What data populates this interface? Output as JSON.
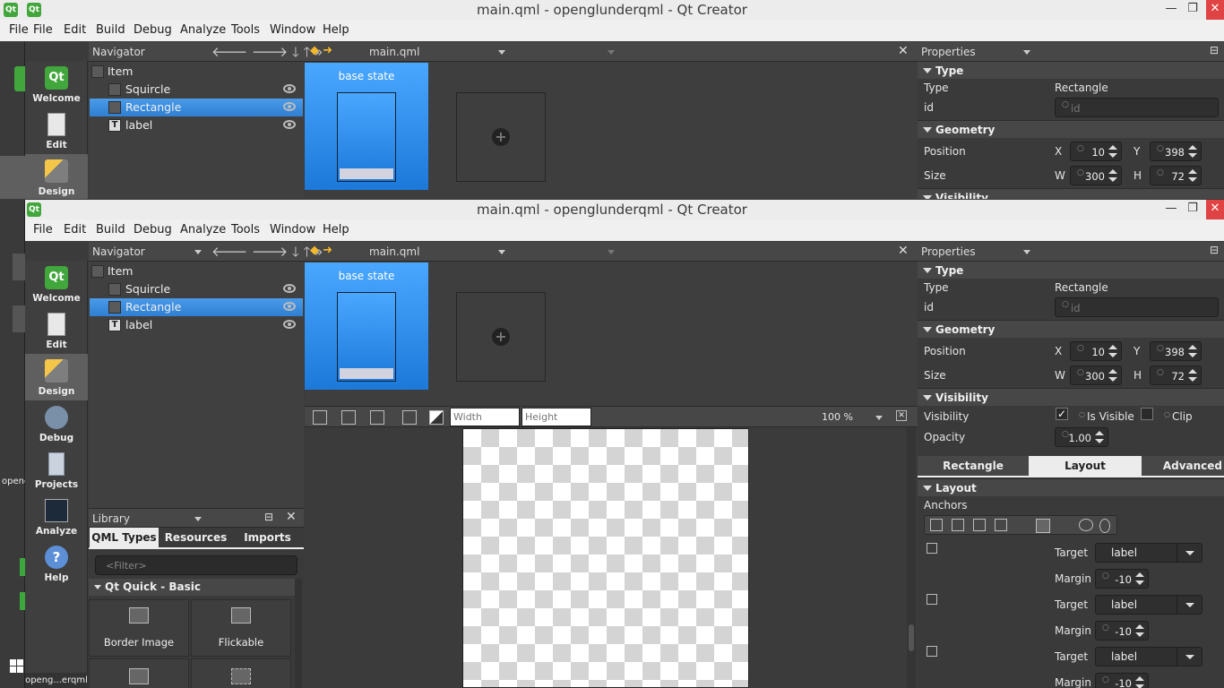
{
  "window": {
    "title": "main.qml - openglunderqml - Qt Creator",
    "qt_icon_text": "Qt",
    "minimize": "—",
    "maximize": "❐",
    "close": "✕"
  },
  "menu": [
    "File",
    "Edit",
    "Build",
    "Debug",
    "Analyze",
    "Tools",
    "Window",
    "Help"
  ],
  "modes": [
    {
      "label": "Welcome",
      "icon": "qt-logo-icon"
    },
    {
      "label": "Edit",
      "icon": "edit-document-icon"
    },
    {
      "label": "Design",
      "icon": "design-brush-icon"
    },
    {
      "label": "Debug",
      "icon": "debug-bug-icon"
    },
    {
      "label": "Projects",
      "icon": "projects-icon"
    },
    {
      "label": "Analyze",
      "icon": "analyze-icon"
    },
    {
      "label": "Help",
      "icon": "help-icon"
    }
  ],
  "navigator": {
    "title": "Navigator",
    "items": [
      {
        "label": "Item"
      },
      {
        "label": "Squircle"
      },
      {
        "label": "Rectangle"
      },
      {
        "label": "label"
      }
    ]
  },
  "editor": {
    "file": "main.qml",
    "state_caption": "base state",
    "width_placeholder": "Width",
    "height_placeholder": "Height",
    "zoom": "100 %"
  },
  "library": {
    "title": "Library",
    "tabs": [
      "QML Types",
      "Resources",
      "Imports"
    ],
    "filter_placeholder": "<Filter>",
    "section": "Qt Quick - Basic",
    "items": [
      "Border Image",
      "Flickable"
    ]
  },
  "properties": {
    "title": "Properties",
    "type_section": "Type",
    "type_label": "Type",
    "type_value": "Rectangle",
    "id_label": "id",
    "id_placeholder": "id",
    "geometry_section": "Geometry",
    "position_label": "Position",
    "size_label": "Size",
    "x_label": "X",
    "y_label": "Y",
    "w_label": "W",
    "h_label": "H",
    "x": "10",
    "y": "398",
    "w": "300",
    "h": "72",
    "visibility_section": "Visibility",
    "visibility_label": "Visibility",
    "is_visible": "Is Visible",
    "clip": "Clip",
    "opacity_label": "Opacity",
    "opacity": "1.00",
    "tabs": [
      "Rectangle",
      "Layout",
      "Advanced"
    ],
    "layout_section": "Layout",
    "anchors_label": "Anchors",
    "target_label": "Target",
    "target_value": "label",
    "margin_label": "Margin",
    "margin_value": "-10"
  },
  "taskbar": {
    "app_label": "openg...erqml",
    "side_label_1": "opene",
    "windows_icon": "windows-start-icon"
  }
}
